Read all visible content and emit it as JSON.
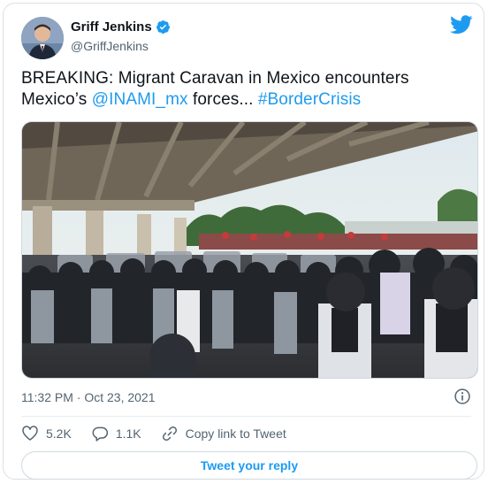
{
  "tweet": {
    "author": {
      "display_name": "Griff Jenkins",
      "handle": "@GriffJenkins",
      "verified_icon": "verified-badge-icon"
    },
    "text": {
      "prefix": "BREAKING: Migrant Caravan in Mexico encounters Mexico’s ",
      "mention": "@INAMI_mx",
      "middle": " forces... ",
      "hashtag": "#BorderCrisis"
    },
    "timestamp": "11:32 PM · Oct 23, 2021",
    "likes": "5.2K",
    "replies": "1.1K",
    "copy_link_label": "Copy link to Tweet",
    "reply_button_label": "Tweet your reply"
  },
  "colors": {
    "accent": "#1d9bf0",
    "text_primary": "#0f1419",
    "text_secondary": "#536471",
    "border": "#cfd9de"
  },
  "icons": [
    "twitter-bird-icon",
    "verified-badge-icon",
    "info-icon",
    "heart-icon",
    "reply-bubble-icon",
    "link-icon"
  ]
}
